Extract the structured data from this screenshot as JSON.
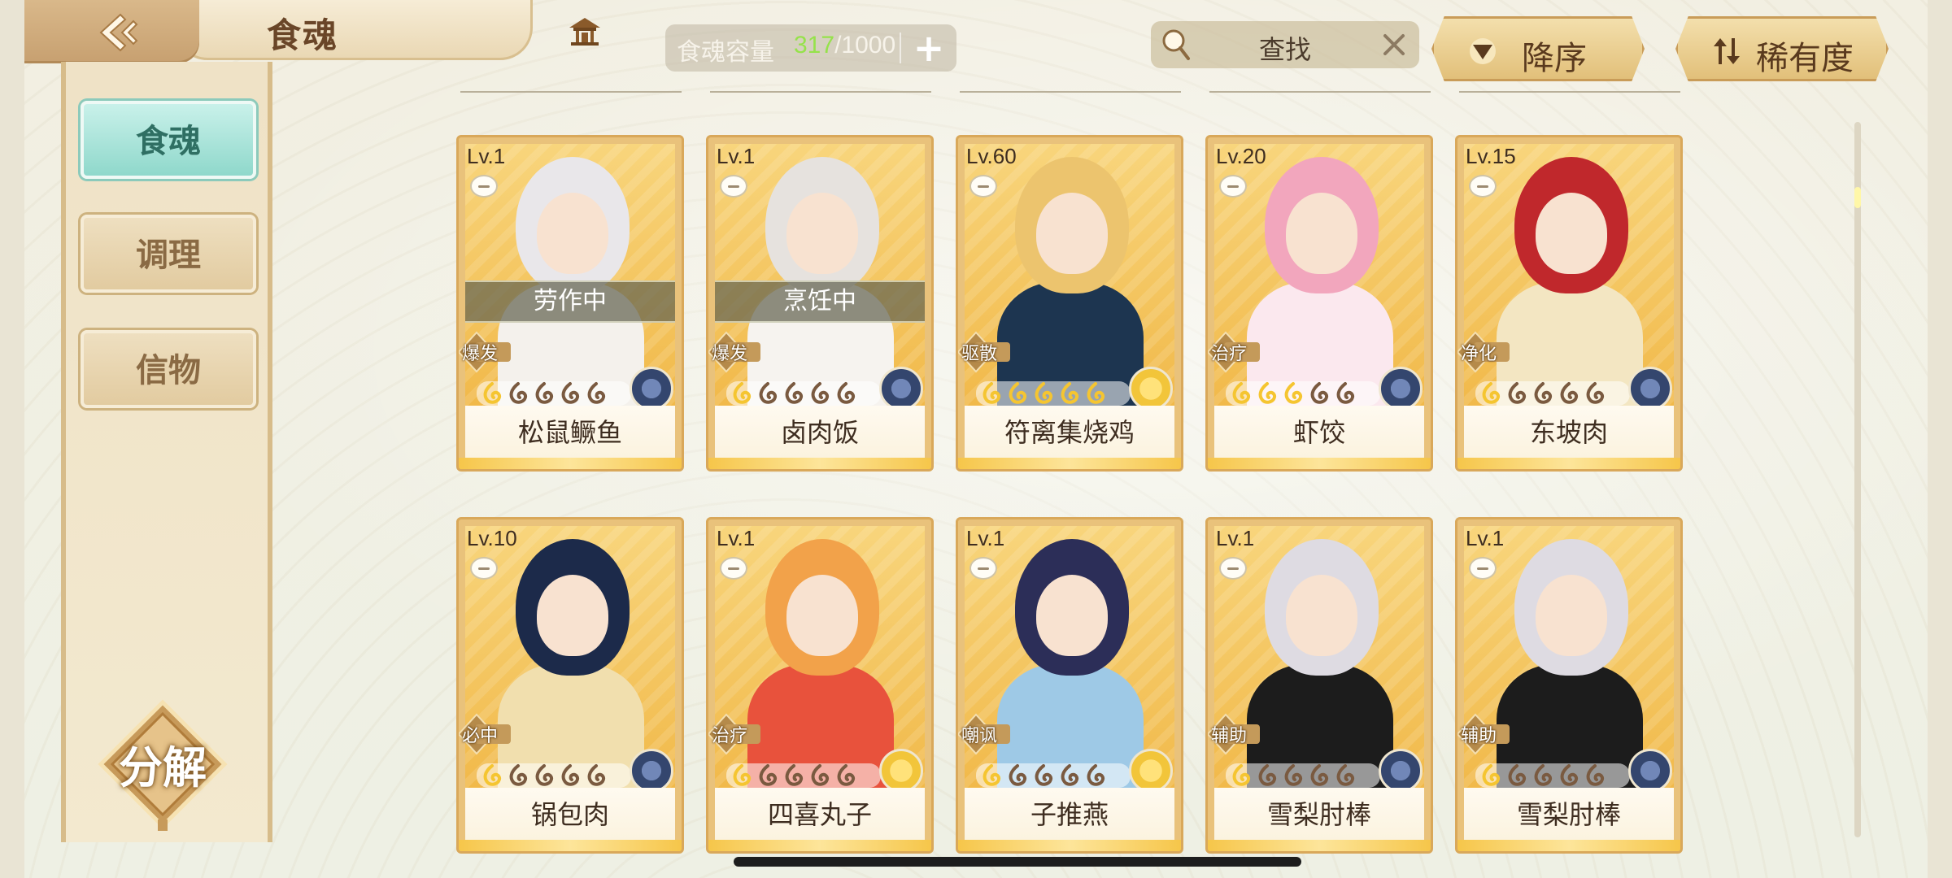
{
  "header": {
    "title": "食魂",
    "capacity_label": "食魂容量",
    "capacity_current": "317",
    "capacity_max": "/1000",
    "search_placeholder": "查找",
    "sort_order_label": "降序",
    "sort_key_label": "稀有度"
  },
  "sidebar": {
    "items": [
      {
        "label": "食魂",
        "active": true
      },
      {
        "label": "调理",
        "active": false
      },
      {
        "label": "信物",
        "active": false
      }
    ],
    "decompose_label": "分解"
  },
  "cards": [
    {
      "level": "Lv.1",
      "name": "松鼠鳜鱼",
      "status": "劳作中",
      "role": "爆发",
      "stars": 1,
      "element": "blue",
      "hair": "#e9e7ea",
      "outfit": "#f4f1ec"
    },
    {
      "level": "Lv.1",
      "name": "卤肉饭",
      "status": "烹饪中",
      "role": "爆发",
      "stars": 1,
      "element": "blue",
      "hair": "#e6e2de",
      "outfit": "#f6f3ef"
    },
    {
      "level": "Lv.60",
      "name": "符离集烧鸡",
      "status": "",
      "role": "驱散",
      "stars": 5,
      "element": "gold",
      "hair": "#ecc46e",
      "outfit": "#1d3550"
    },
    {
      "level": "Lv.20",
      "name": "虾饺",
      "status": "",
      "role": "治疗",
      "stars": 3,
      "element": "blue",
      "hair": "#f2a6bd",
      "outfit": "#fbe8ee"
    },
    {
      "level": "Lv.15",
      "name": "东坡肉",
      "status": "",
      "role": "净化",
      "stars": 1,
      "element": "blue",
      "hair": "#c0282c",
      "outfit": "#f3e6c2"
    },
    {
      "level": "Lv.10",
      "name": "锅包肉",
      "status": "",
      "role": "必中",
      "stars": 1,
      "element": "blue",
      "hair": "#1c2a4a",
      "outfit": "#f1dfae"
    },
    {
      "level": "Lv.1",
      "name": "四喜丸子",
      "status": "",
      "role": "治疗",
      "stars": 1,
      "element": "gold",
      "hair": "#f2a24a",
      "outfit": "#e8523c"
    },
    {
      "level": "Lv.1",
      "name": "子推燕",
      "status": "",
      "role": "嘲讽",
      "stars": 1,
      "element": "gold",
      "hair": "#2c2e58",
      "outfit": "#9ec9e6"
    },
    {
      "level": "Lv.1",
      "name": "雪梨肘棒",
      "status": "",
      "role": "辅助",
      "stars": 1,
      "element": "blue",
      "hair": "#dedbe2",
      "outfit": "#1c1c1c"
    },
    {
      "level": "Lv.1",
      "name": "雪梨肘棒",
      "status": "",
      "role": "辅助",
      "stars": 1,
      "element": "blue",
      "hair": "#dedbe2",
      "outfit": "#1c1c1c"
    }
  ],
  "icons": {
    "back": "back-arrow-icon",
    "home": "pavilion-icon",
    "add": "plus-icon",
    "search": "magnifier-icon",
    "clear": "close-icon",
    "sort_order": "triangle-down-icon",
    "sort_key": "sort-arrows-icon"
  },
  "colors": {
    "capacity_current": "#96e24b",
    "active_tab": "#8fd8cb",
    "card_frame": "#e9c27b",
    "element_blue": "#34466e",
    "element_gold": "#f2c53a"
  }
}
